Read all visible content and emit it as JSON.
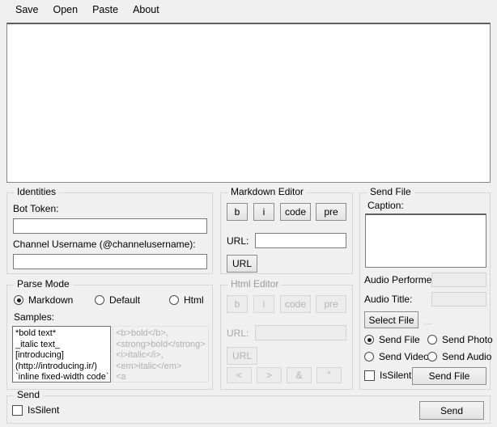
{
  "menu": {
    "items": [
      {
        "label": "Save",
        "name": "menu-save"
      },
      {
        "label": "Open",
        "name": "menu-open"
      },
      {
        "label": "Paste",
        "name": "menu-paste"
      },
      {
        "label": "About",
        "name": "menu-about"
      }
    ]
  },
  "main_editor": {
    "value": "",
    "placeholder": ""
  },
  "identities": {
    "title": "Identities",
    "bot_token_label": "Bot Token:",
    "bot_token_value": "",
    "channel_label": "Channel Username (@channelusername):",
    "channel_value": ""
  },
  "parse_mode": {
    "title": "Parse Mode",
    "options": [
      {
        "label": "Markdown",
        "selected": true
      },
      {
        "label": "Default",
        "selected": false
      },
      {
        "label": "Html",
        "selected": false
      }
    ],
    "samples_label": "Samples:",
    "markdown_sample": "*bold text*\n_italic text_\n[introducing]\n(http://introducing.ir/)\n`inline fixed-width code`",
    "html_sample": "<b>bold</b>,\n<strong>bold</strong>\n<i>italic</i>,\n<em>italic</em>\n<a"
  },
  "markdown_editor": {
    "title": "Markdown Editor",
    "buttons": [
      "b",
      "i",
      "code",
      "pre"
    ],
    "url_label": "URL:",
    "url_value": "",
    "url_button": "URL"
  },
  "html_editor": {
    "title": "Html Editor",
    "buttons": [
      "b",
      "i",
      "code",
      "pre"
    ],
    "url_label": "URL:",
    "url_value": "",
    "url_button": "URL",
    "entity_buttons": [
      "<",
      ">",
      "&",
      "\""
    ]
  },
  "send_file": {
    "title": "Send File",
    "caption_label": "Caption:",
    "caption_value": "",
    "audio_performer_label": "Audio Performer:",
    "audio_performer_value": "",
    "audio_title_label": "Audio Title:",
    "audio_title_value": "",
    "select_file_button": "Select File",
    "selected_file_text": "...",
    "modes": [
      {
        "label": "Send File",
        "selected": true
      },
      {
        "label": "Send Photo",
        "selected": false
      },
      {
        "label": "Send Video",
        "selected": false
      },
      {
        "label": "Send Audio",
        "selected": false
      }
    ],
    "is_silent_label": "IsSilent",
    "is_silent_checked": false,
    "send_button": "Send File"
  },
  "send": {
    "title": "Send",
    "is_silent_label": "IsSilent",
    "is_silent_checked": false,
    "send_button": "Send"
  }
}
